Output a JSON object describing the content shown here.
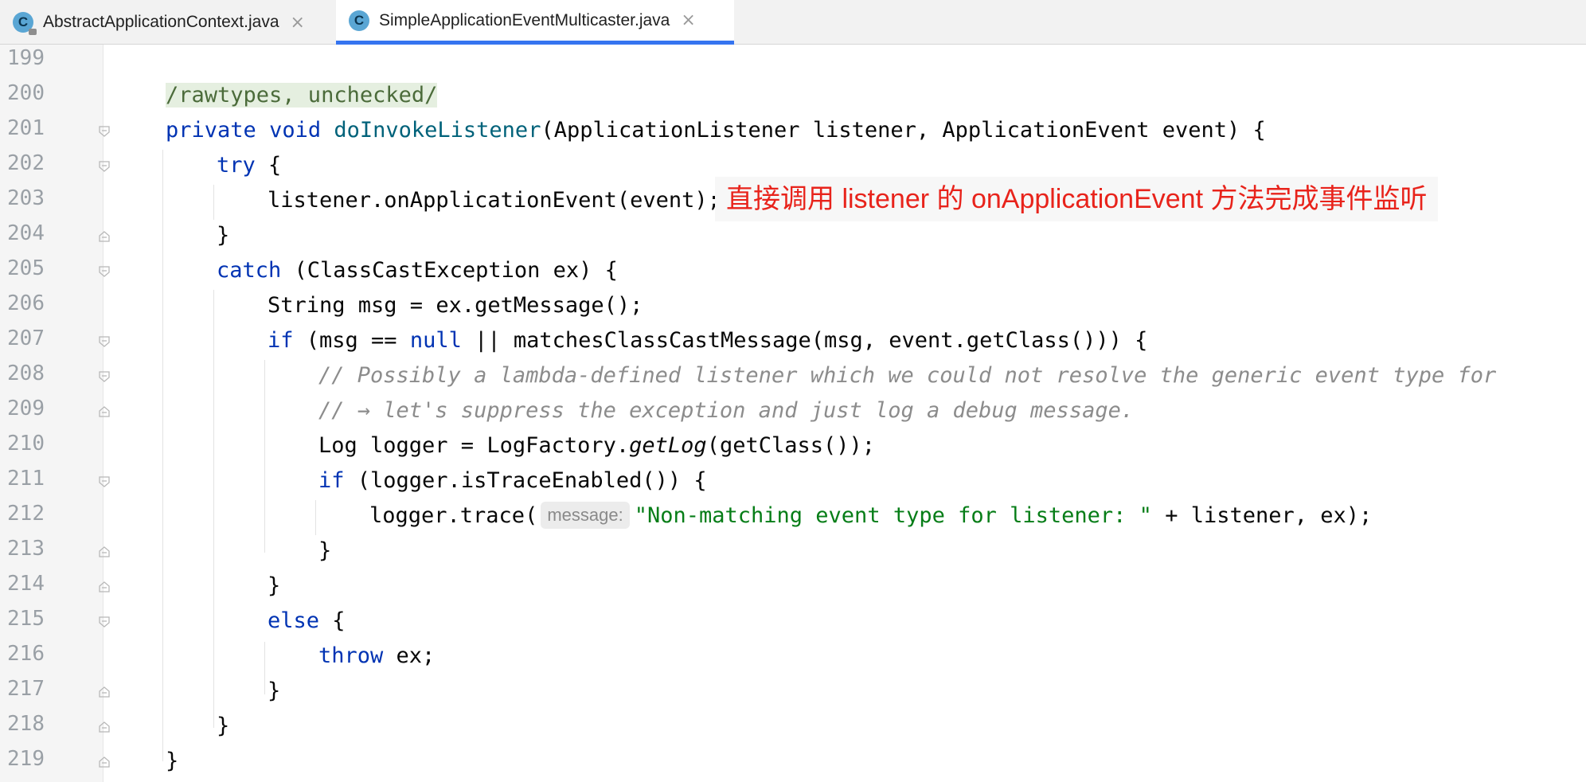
{
  "tabs": [
    {
      "label": "AbstractApplicationContext.java",
      "icon": "class-file-icon",
      "active": false
    },
    {
      "label": "SimpleApplicationEventMulticaster.java",
      "icon": "class-file-icon",
      "active": true
    }
  ],
  "tab_icon_letter": "C",
  "close_glyph": "×",
  "line_numbers": [
    "199",
    "200",
    "201",
    "202",
    "203",
    "204",
    "205",
    "206",
    "207",
    "208",
    "209",
    "210",
    "211",
    "212",
    "213",
    "214",
    "215",
    "216",
    "217",
    "218",
    "219"
  ],
  "code": {
    "l200": "/rawtypes, unchecked/",
    "l201": {
      "kw1": "private",
      "kw2": "void",
      "fn": "doInvokeListener",
      "rest": "(ApplicationListener listener, ApplicationEvent event) {"
    },
    "l202": {
      "kw": "try",
      "rest": " {"
    },
    "l203": "listener.onApplicationEvent(event);",
    "l204": "}",
    "l205": {
      "kw": "catch",
      "rest": " (ClassCastException ex) {"
    },
    "l206": "String msg = ex.getMessage();",
    "l207": {
      "kw1": "if",
      "mid": " (msg == ",
      "kw2": "null",
      "rest": " || matchesClassCastMessage(msg, event.getClass())) {"
    },
    "l208": "// Possibly a lambda-defined listener which we could not resolve the generic event type for",
    "l209": "// → let's suppress the exception and just log a debug message.",
    "l210": {
      "pre": "Log logger = LogFactory.",
      "it": "getLog",
      "rest": "(getClass());"
    },
    "l211": {
      "kw": "if",
      "rest": " (logger.isTraceEnabled()) {"
    },
    "l212": {
      "pre": "logger.trace(",
      "hint": "message:",
      "str": "\"Non-matching event type for listener: \"",
      "rest": " + listener, ex);"
    },
    "l213": "}",
    "l214": "}",
    "l215": {
      "kw": "else",
      "rest": " {"
    },
    "l216": {
      "kw": "throw",
      "rest": " ex;"
    },
    "l217": "}",
    "l218": "}",
    "l219": "}"
  },
  "annotation_note": "直接调用 listener 的 onApplicationEvent 方法完成事件监听",
  "colors": {
    "keyword": "#0033b3",
    "method": "#00627a",
    "comment": "#8c8c8c",
    "string": "#067d17",
    "note": "#e8231b",
    "active_tab_underline": "#3574f0"
  }
}
